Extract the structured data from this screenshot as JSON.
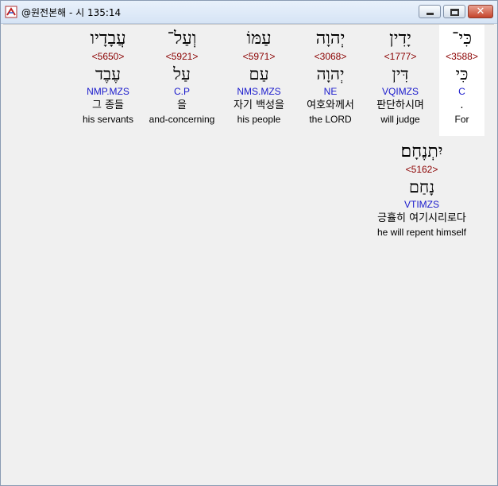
{
  "window": {
    "title": "@원전본해 - 시 135:14"
  },
  "words": [
    {
      "hebrew": "כִּי־",
      "strong": "<3588>",
      "root": "כִּי",
      "parse": "C",
      "korean": ".",
      "english": "For"
    },
    {
      "hebrew": "יָדִין",
      "strong": "<1777>",
      "root": "דִּין",
      "parse": "VQIMZS",
      "korean": "판단하시며",
      "english": "will judge"
    },
    {
      "hebrew": "יְהוָה",
      "strong": "<3068>",
      "root": "יְהוָה",
      "parse": "NE",
      "korean": "여호와께서",
      "english": "the LORD"
    },
    {
      "hebrew": "עַמּוֹ",
      "strong": "<5971>",
      "root": "עַם",
      "parse": "NMS.MZS",
      "korean": "자기 백성을",
      "english": "his people"
    },
    {
      "hebrew": "וְעַל־",
      "strong": "<5921>",
      "root": "עַל",
      "parse": "C.P",
      "korean": "을",
      "english": "and-concerning"
    },
    {
      "hebrew": "עֲבָדָיו",
      "strong": "<5650>",
      "root": "עֶבֶד",
      "parse": "NMP.MZS",
      "korean": "그 종들",
      "english": "his servants"
    },
    {
      "hebrew": "יִתְנֶחָם׃",
      "strong": "<5162>",
      "root": "נָחַם",
      "parse": "VTIMZS",
      "korean": "긍휼히 여기시리로다",
      "english": "he will repent himself"
    }
  ]
}
